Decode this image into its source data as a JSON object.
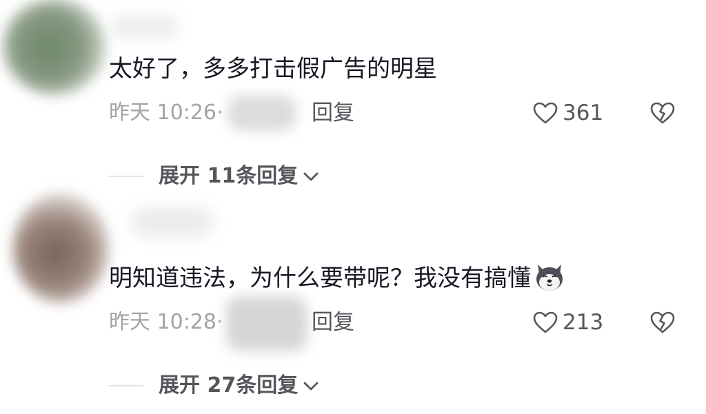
{
  "comments": [
    {
      "text": "太好了，多多打击假广告的明星",
      "time": "昨天 10:26",
      "dot": "·",
      "reply_label": "回复",
      "like_count": "361",
      "expand_label": "展开 11条回复",
      "has_emoji": false
    },
    {
      "text": "明知道违法，为什么要带呢？我没有搞懂",
      "time": "昨天 10:28",
      "dot": "·",
      "reply_label": "回复",
      "like_count": "213",
      "expand_label": "展开 27条回复",
      "has_emoji": true
    }
  ],
  "icons": {
    "like": "heart-outline-icon",
    "dislike": "broken-heart-icon",
    "expand": "chevron-down-icon",
    "emoji": "husky-dog-emoji-icon"
  },
  "colors": {
    "primary_text": "#161823",
    "secondary_text": "#a3a3a8",
    "action_text": "#55565b",
    "divider": "#e3e3e5"
  }
}
